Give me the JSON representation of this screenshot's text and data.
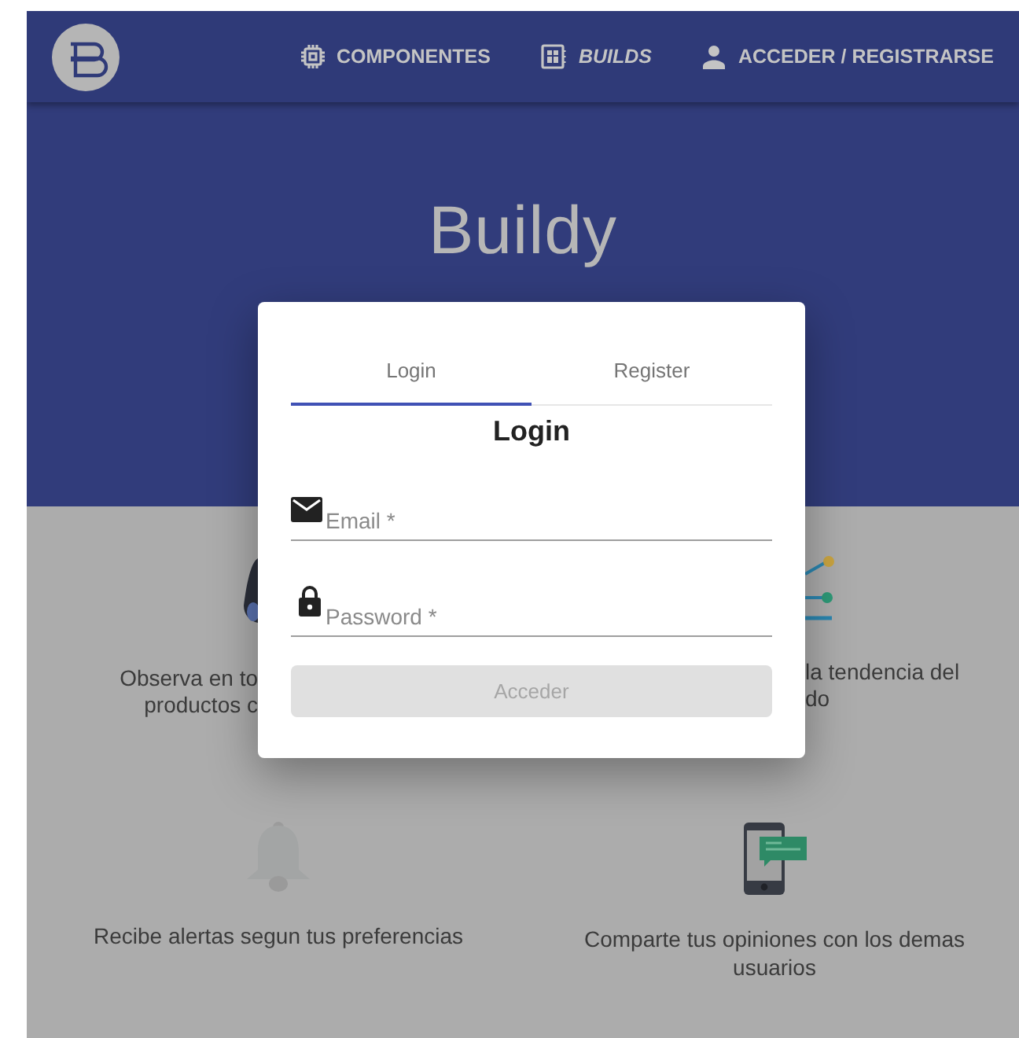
{
  "header": {
    "nav": [
      {
        "label": "COMPONENTES",
        "selected": false
      },
      {
        "label": "BUILDS",
        "selected": true
      },
      {
        "label": "ACCEDER / REGISTRARSE",
        "selected": false
      }
    ]
  },
  "hero": {
    "title": "Buildy"
  },
  "features_top": {
    "left_lines": [
      "Observa en to",
      "productos c"
    ],
    "right_lines": [
      "la tendencia del",
      "do"
    ]
  },
  "features_bottom": [
    {
      "text": "Recibe alertas segun tus preferencias"
    },
    {
      "text": "Comparte tus opiniones con los demas usuarios"
    }
  ],
  "dialog": {
    "tabs": [
      {
        "label": "Login",
        "selected": true
      },
      {
        "label": "Register",
        "selected": false
      }
    ],
    "heading": "Login",
    "fields": [
      {
        "kind": "email",
        "placeholder": "Email *"
      },
      {
        "kind": "password",
        "placeholder": "Password *"
      }
    ],
    "button": {
      "label": "Acceder",
      "disabled": true
    }
  }
}
